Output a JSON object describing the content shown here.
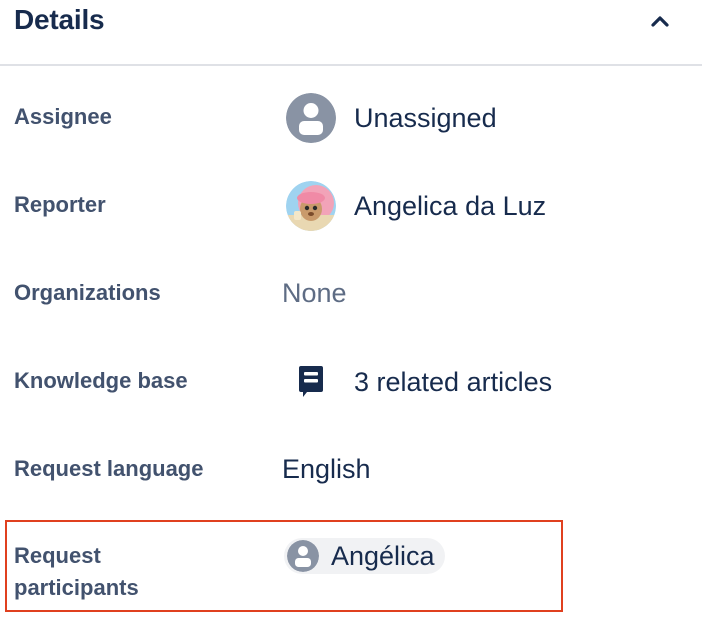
{
  "panel": {
    "title": "Details",
    "collapse_icon": "chevron-up-icon"
  },
  "fields": {
    "assignee": {
      "label": "Assignee",
      "value": "Unassigned",
      "icon": "default-user-avatar"
    },
    "reporter": {
      "label": "Reporter",
      "value": "Angelica da Luz",
      "icon": "user-avatar-photo"
    },
    "organizations": {
      "label": "Organizations",
      "value": "None"
    },
    "knowledge_base": {
      "label": "Knowledge base",
      "value": "3 related articles",
      "icon": "book-icon"
    },
    "request_language": {
      "label": "Request language",
      "value": "English"
    },
    "request_participants": {
      "label_line1": "Request",
      "label_line2": "participants",
      "participant": "Angélica",
      "icon": "default-user-avatar"
    }
  },
  "colors": {
    "highlight": "#e0401f",
    "label": "#42526e",
    "value": "#172b4d",
    "muted": "#5e6c84",
    "divider": "#dfe1e6"
  }
}
